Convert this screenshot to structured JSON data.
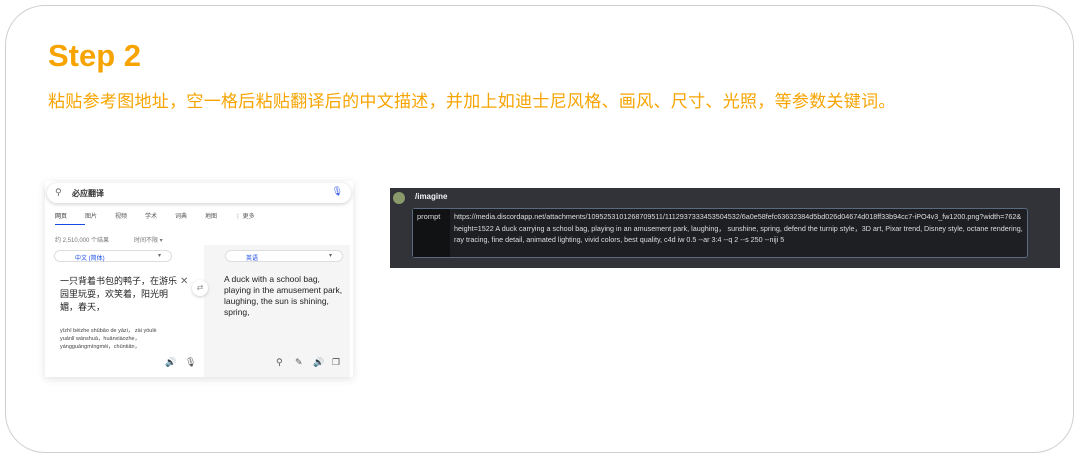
{
  "step": {
    "title": "Step 2",
    "description": "粘贴参考图地址，空一格后粘贴翻译后的中文描述，并加上如迪士尼风格、画风、尺寸、光照，等参数关键词。"
  },
  "bing": {
    "query": "必应翻译",
    "tabs": [
      "网页",
      "图片",
      "视频",
      "学术",
      "词典",
      "地图",
      "⋮ 更多"
    ],
    "result_count": "约 2,510,000 个结果",
    "time_filter": "时间不限 ▾",
    "source_lang": "中文 (简体)",
    "target_lang": "英语",
    "source_text": "一只背着书包的鸭子，在游乐园里玩耍，欢笑着，阳光明媚，春天，",
    "pinyin": [
      "yīzhī bèizhe shūbāo de yāzi，  zài yóulè",
      "yuánlǐ wánshuǎ，huānxiàozhe，",
      "yángguāngmíngmèi，chūntiān，"
    ],
    "translation": "A duck with a school bag, playing in the amusement park, laughing, the sun is shining, spring,"
  },
  "discord": {
    "command": "/imagine",
    "prompt_label": "prompt",
    "prompt_text": "https://media.discordapp.net/attachments/1095253101268709511/1112937333453504532/6a0e58fefc63632384d5bd026d04674d018ff33b94cc7-iPO4v3_fw1200.png?width=762&height=1522 A duck carrying a school bag, playing in an amusement park, laughing，  sunshine, spring, defend the turnip style，3D art, Pixar trend, Disney style, octane rendering, ray tracing, fine detail, animated lighting, vivid colors, best quality, c4d iw 0.5 --ar 3:4 --q 2 --s 250 --niji 5"
  }
}
